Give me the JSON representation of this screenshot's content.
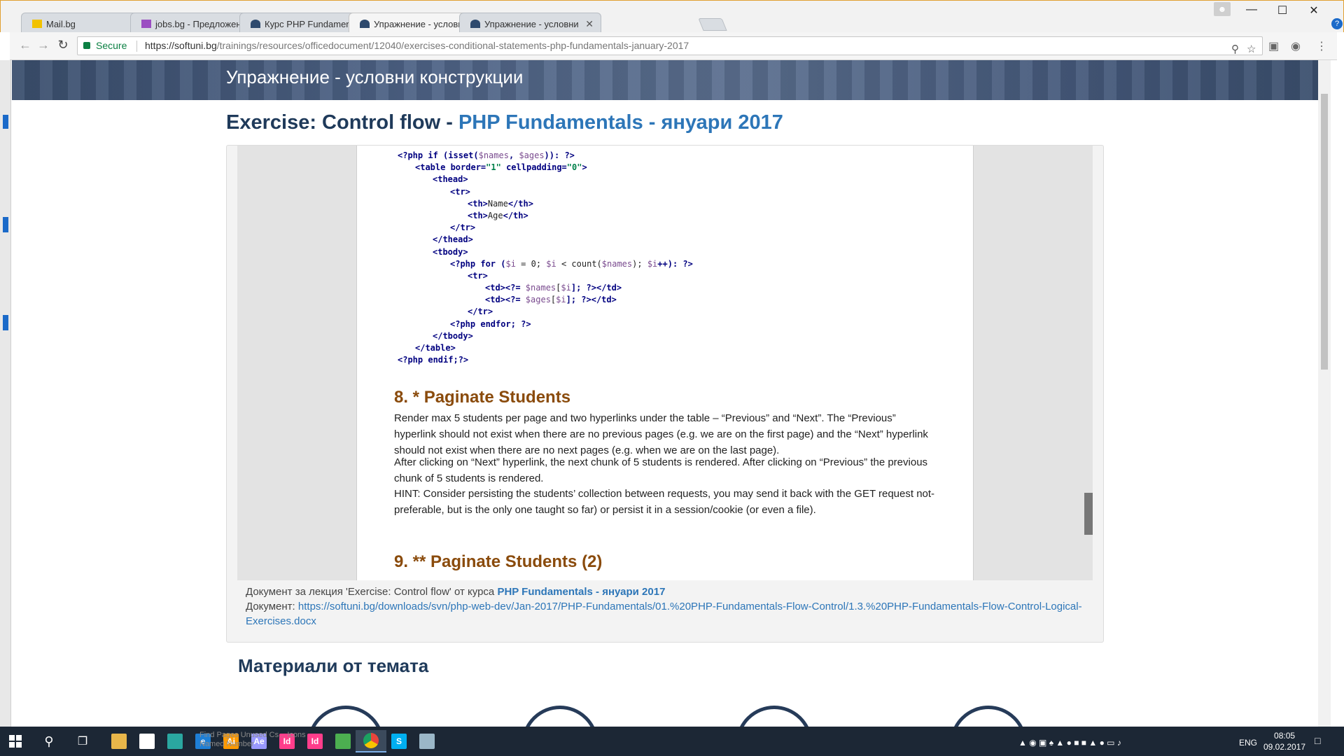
{
  "browser": {
    "tabs": [
      {
        "label": "Mail.bg",
        "favicon_color": "#f2c200"
      },
      {
        "label": "jobs.bg - Предложения",
        "favicon_color": "#9b4ec2"
      },
      {
        "label": "Курс PHP Fundamentals",
        "favicon_color": "#2e4a6e"
      },
      {
        "label": "Упражнение - условни",
        "favicon_color": "#2e4a6e"
      },
      {
        "label": "Упражнение - условни",
        "favicon_color": "#2e4a6e"
      }
    ],
    "active_tab_index": 3,
    "secure_label": "Secure",
    "url_host": "https://softuni.bg",
    "url_path": "/trainings/resources/officedocument/12040/exercises-conditional-statements-php-fundamentals-january-2017"
  },
  "page": {
    "banner_title": "Упражнение - условни конструкции",
    "title_prefix": "Exercise: Control flow -",
    "title_link": "PHP Fundamentals - януари 2017"
  },
  "document": {
    "code_lines": [
      {
        "indent": 0,
        "parts": [
          {
            "t": "<?php if ",
            "c": "kw"
          },
          {
            "t": "(isset(",
            "c": "kw"
          },
          {
            "t": "$names",
            "c": "var"
          },
          {
            "t": ", ",
            "c": "kw"
          },
          {
            "t": "$ages",
            "c": "var"
          },
          {
            "t": ")): ?>",
            "c": "kw"
          }
        ]
      },
      {
        "indent": 1,
        "parts": [
          {
            "t": "<table ",
            "c": "kw"
          },
          {
            "t": "border=",
            "c": "kw"
          },
          {
            "t": "\"1\"",
            "c": "str"
          },
          {
            "t": " cellpadding=",
            "c": "kw"
          },
          {
            "t": "\"0\"",
            "c": "str"
          },
          {
            "t": ">",
            "c": "kw"
          }
        ]
      },
      {
        "indent": 2,
        "parts": [
          {
            "t": "<thead>",
            "c": "kw"
          }
        ]
      },
      {
        "indent": 3,
        "parts": [
          {
            "t": "<tr>",
            "c": "kw"
          }
        ]
      },
      {
        "indent": 4,
        "parts": [
          {
            "t": "<th>",
            "c": "kw"
          },
          {
            "t": "Name",
            "c": "txt"
          },
          {
            "t": "</th>",
            "c": "kw"
          }
        ]
      },
      {
        "indent": 4,
        "parts": [
          {
            "t": "<th>",
            "c": "kw"
          },
          {
            "t": "Age",
            "c": "txt"
          },
          {
            "t": "</th>",
            "c": "kw"
          }
        ]
      },
      {
        "indent": 3,
        "parts": [
          {
            "t": "</tr>",
            "c": "kw"
          }
        ]
      },
      {
        "indent": 2,
        "parts": [
          {
            "t": "</thead>",
            "c": "kw"
          }
        ]
      },
      {
        "indent": 2,
        "parts": [
          {
            "t": "<tbody>",
            "c": "kw"
          }
        ]
      },
      {
        "indent": 3,
        "parts": [
          {
            "t": "<?php for ",
            "c": "kw"
          },
          {
            "t": "(",
            "c": "kw"
          },
          {
            "t": "$i",
            "c": "var"
          },
          {
            "t": " = 0; ",
            "c": "txt"
          },
          {
            "t": "$i",
            "c": "var"
          },
          {
            "t": " < count(",
            "c": "txt"
          },
          {
            "t": "$names",
            "c": "var"
          },
          {
            "t": "); ",
            "c": "txt"
          },
          {
            "t": "$i",
            "c": "var"
          },
          {
            "t": "++): ?>",
            "c": "kw"
          }
        ]
      },
      {
        "indent": 4,
        "parts": [
          {
            "t": "<tr>",
            "c": "kw"
          }
        ]
      },
      {
        "indent": 5,
        "parts": [
          {
            "t": "<td><?= ",
            "c": "kw"
          },
          {
            "t": "$names",
            "c": "var"
          },
          {
            "t": "[",
            "c": "txt"
          },
          {
            "t": "$i",
            "c": "var"
          },
          {
            "t": "]; ?></td>",
            "c": "kw"
          }
        ]
      },
      {
        "indent": 5,
        "parts": [
          {
            "t": "<td><?= ",
            "c": "kw"
          },
          {
            "t": "$ages",
            "c": "var"
          },
          {
            "t": "[",
            "c": "txt"
          },
          {
            "t": "$i",
            "c": "var"
          },
          {
            "t": "]; ?></td>",
            "c": "kw"
          }
        ]
      },
      {
        "indent": 4,
        "parts": [
          {
            "t": "</tr>",
            "c": "kw"
          }
        ]
      },
      {
        "indent": 3,
        "parts": [
          {
            "t": "<?php endfor; ?>",
            "c": "kw"
          }
        ]
      },
      {
        "indent": 2,
        "parts": [
          {
            "t": "</tbody>",
            "c": "kw"
          }
        ]
      },
      {
        "indent": 1,
        "parts": [
          {
            "t": "</table>",
            "c": "kw"
          }
        ]
      },
      {
        "indent": 0,
        "parts": [
          {
            "t": "<?php endif;?>",
            "c": "kw"
          }
        ]
      }
    ],
    "heading_8": "8. * Paginate Students",
    "paragraph_1": "Render max 5 students per page and two hyperlinks under the table – “Previous” and “Next”. The “Previous” hyperlink should not exist when there are no previous pages (e.g. we are on the first page) and the “Next” hyperlink should not exist when there are no next pages (e.g. when we are on the last page).",
    "paragraph_2": "After clicking on “Next” hyperlink, the next chunk of 5 students is rendered. After clicking on “Previous” the previous chunk of 5 students is rendered.",
    "paragraph_3": "HINT: Consider persisting the students’ collection between requests, you may send it back with the GET request not-preferable, but is the only one taught so far) or persist it in a session/cookie (or even a file).",
    "heading_9": "9. ** Paginate Students (2)"
  },
  "caption": {
    "line1_prefix": "Документ за лекция 'Exercise: Control flow' от курса",
    "line1_link": "PHP Fundamentals - януари 2017",
    "line2_prefix": "Документ:",
    "line2_link": "https://softuni.bg/downloads/svn/php-web-dev/Jan-2017/PHP-Fundamentals/01.%20PHP-Fundamentals-Flow-Control/1.3.%20PHP-Fundamentals-Flow-Control-Logical-Exercises.docx"
  },
  "materials_title": "Материали от темата",
  "taskbar": {
    "apps": [
      {
        "name": "file-explorer-icon",
        "label": "",
        "color": "#e8b64a"
      },
      {
        "name": "store-icon",
        "label": "",
        "color": "#ffffff"
      },
      {
        "name": "app-icon",
        "label": "",
        "color": "#2aa7a0"
      },
      {
        "name": "edge-icon",
        "label": "e",
        "color": "#1e7fd6"
      },
      {
        "name": "illustrator-icon",
        "label": "Ai",
        "color": "#ff9a00"
      },
      {
        "name": "after-effects-icon",
        "label": "Ae",
        "color": "#9999ff"
      },
      {
        "name": "indesign-icon",
        "label": "Id",
        "color": "#ff3d8b"
      },
      {
        "name": "indesign-icon-2",
        "label": "Id",
        "color": "#ff3d8b"
      },
      {
        "name": "green-app-icon",
        "label": "",
        "color": "#4caf50"
      },
      {
        "name": "chrome-icon",
        "label": "",
        "color": "#e8453c"
      },
      {
        "name": "skype-icon",
        "label": "S",
        "color": "#00aff0"
      },
      {
        "name": "bird-app-icon",
        "label": "",
        "color": "#9bb7c8"
      }
    ],
    "ghost_text_1": "Find Pages Unused Cs... Icons",
    "ghost_text_2": "Named Number",
    "lang": "ENG",
    "time": "08:05",
    "date": "09.02.2017"
  }
}
